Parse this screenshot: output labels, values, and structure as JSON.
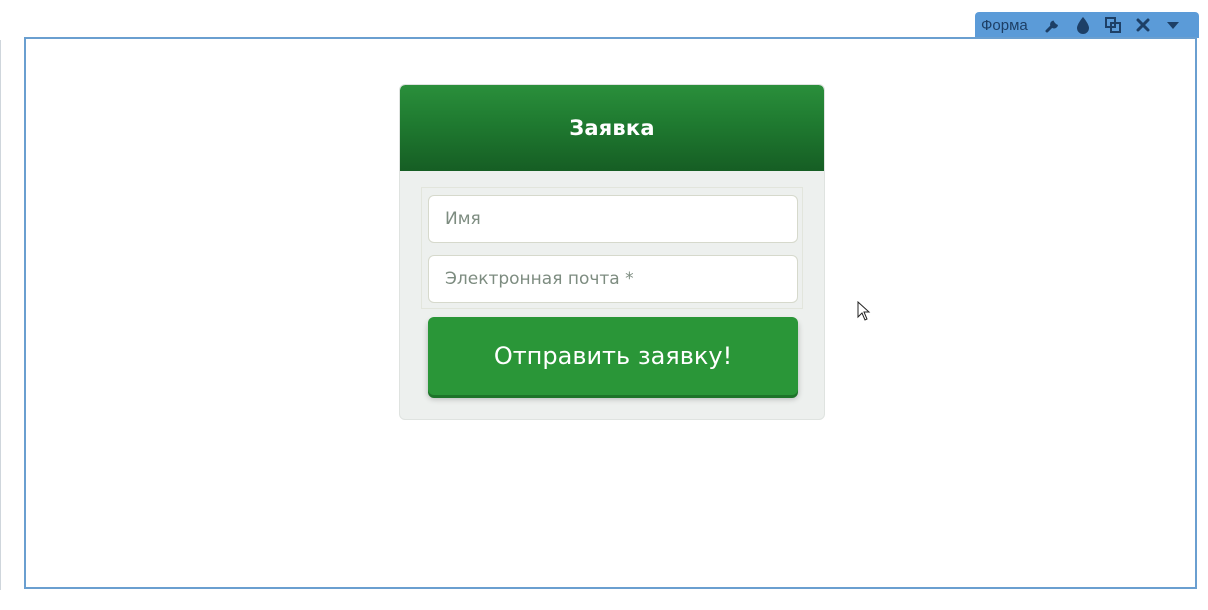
{
  "toolbar": {
    "label": "Форма",
    "buttons": [
      {
        "name": "settings",
        "icon": "wrench-icon"
      },
      {
        "name": "style",
        "icon": "drop-icon"
      },
      {
        "name": "duplicate",
        "icon": "copy-icon"
      },
      {
        "name": "delete",
        "icon": "close-icon"
      },
      {
        "name": "more",
        "icon": "caret-down-icon"
      }
    ]
  },
  "form": {
    "title": "Заявка",
    "name_placeholder": "Имя",
    "email_placeholder": "Электронная почта *",
    "submit_label": "Отправить заявку!"
  },
  "colors": {
    "frame_border": "#6a9fd0",
    "toolbar_bg": "#5b9bd8",
    "header_green": "#1f7a30",
    "button_green": "#2a9638"
  }
}
